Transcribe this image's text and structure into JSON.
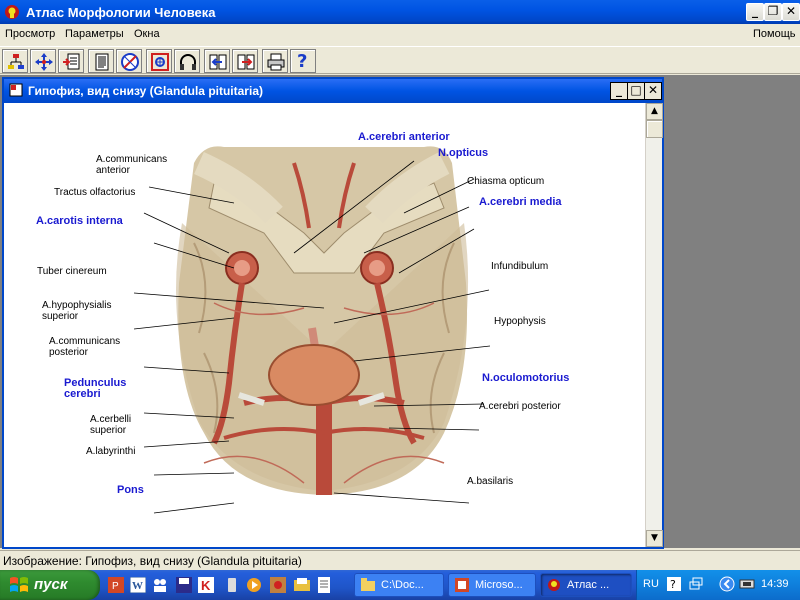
{
  "window": {
    "title": "Атлас Морфологии Человека",
    "controls": {
      "minimize": "_",
      "restore": "❐",
      "close": "✕"
    }
  },
  "menu": {
    "items": [
      "Просмотр",
      "Параметры",
      "Окна"
    ],
    "help": "Помощь"
  },
  "toolbar": {
    "buttons": [
      "hierarchy-icon",
      "move-arrows-icon",
      "import-page-icon",
      "document-icon",
      "compass-icon",
      "zoom-frame-icon",
      "headphones-icon",
      "back-page-icon",
      "forward-page-icon",
      "print-icon",
      "help-icon"
    ],
    "help_glyph": "?"
  },
  "child_window": {
    "title": "Гипофиз, вид снизу (Glandula pituitaria)",
    "controls": {
      "minimize": "_",
      "maximize": "□",
      "close": "✕"
    }
  },
  "illustration": {
    "labels": {
      "a_cerebri_anterior": "A.cerebri anterior",
      "a_communicans_anterior": "A.communicans\nanterior",
      "n_opticus": "N.opticus",
      "tractus_olfactorius": "Tractus olfactorius",
      "chiasma_opticum": "Chiasma opticum",
      "a_carotis_interna": "A.carotis interna",
      "a_cerebri_media": "A.cerebri media",
      "tuber_cinereum": "Tuber cinereum",
      "infundibulum": "Infundibulum",
      "a_hypophysialis_superior": "A.hypophysialis\nsuperior",
      "hypophysis": "Hypophysis",
      "a_communicans_posterior": "A.communicans\nposterior",
      "pedunculus_cerebri": "Pedunculus\ncerebri",
      "n_oculomotorius": "N.oculomotorius",
      "a_cerebri_posterior": "A.cerebri posterior",
      "a_cerbelli_superior": "A.cerbelli\nsuperior",
      "a_labyrinthi": "A.labyrinthi",
      "a_basilaris": "A.basilaris",
      "pons": "Pons"
    }
  },
  "status": {
    "text": "Изображение: Гипофиз, вид снизу (Glandula pituitaria)"
  },
  "taskbar": {
    "start_label": "пуск",
    "tasks": [
      "C:\\Doc...",
      "Microso...",
      "Атлас ..."
    ],
    "language": "RU",
    "clock": "14:39"
  },
  "colors": {
    "label_blue": "#1a1ad0",
    "titlebar": "#0054e3",
    "start_green": "#2f8b2f"
  }
}
